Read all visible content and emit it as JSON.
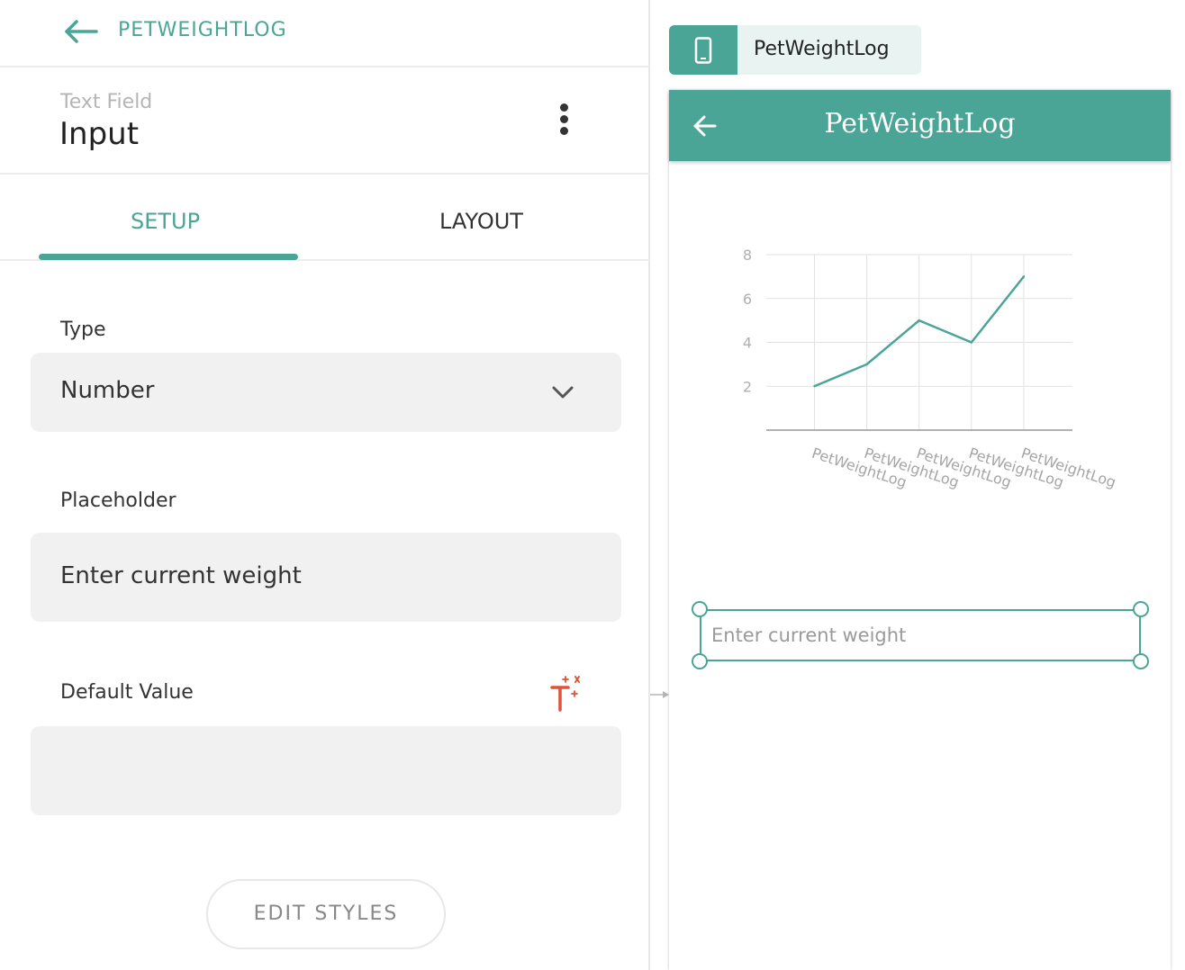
{
  "topbar": {
    "app_name": "PETWEIGHTLOG"
  },
  "component": {
    "type_label": "Text Field",
    "name": "Input"
  },
  "tabs": [
    {
      "label": "SETUP",
      "active": true
    },
    {
      "label": "LAYOUT",
      "active": false
    }
  ],
  "fields": {
    "type": {
      "label": "Type",
      "value": "Number"
    },
    "placeholder": {
      "label": "Placeholder",
      "value": "Enter current weight"
    },
    "default_value": {
      "label": "Default Value",
      "value": ""
    }
  },
  "edit_styles_label": "EDIT STYLES",
  "preview": {
    "screen_chip_label": "PetWeightLog",
    "header_title": "PetWeightLog",
    "input_placeholder": "Enter current weight"
  },
  "colors": {
    "accent": "#4aa596",
    "magic_icon": "#e0523a"
  },
  "icons": [
    "back-arrow-icon",
    "more-vert-icon",
    "chevron-down-icon",
    "magic-text-icon",
    "phone-icon"
  ],
  "chart_data": {
    "type": "line",
    "categories": [
      "PetWeightLog",
      "PetWeightLog",
      "PetWeightLog",
      "PetWeightLog",
      "PetWeightLog"
    ],
    "values": [
      2,
      3,
      5,
      4,
      7
    ],
    "yticks": [
      2,
      4,
      6,
      8
    ],
    "ylim": [
      0,
      8
    ],
    "grid": true,
    "title": "",
    "xlabel": "",
    "ylabel": ""
  }
}
